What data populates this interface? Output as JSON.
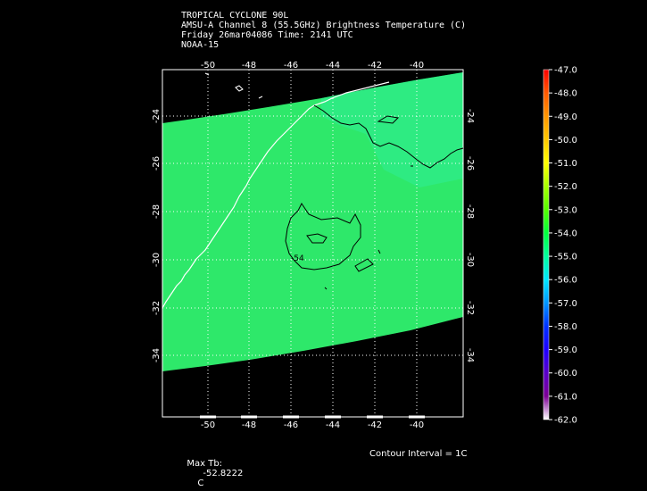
{
  "header": {
    "line1": "TROPICAL CYCLONE 90L",
    "line2": "AMSU-A Channel 8 (55.5GHz) Brightness Temperature (C)",
    "line3": "Friday 26mar04086 Time: 2141 UTC",
    "line4": "NOAA-15"
  },
  "map": {
    "lon_ticks": [
      "-50",
      "-48",
      "-46",
      "-44",
      "-42",
      "-40"
    ],
    "lat_ticks": [
      "-24",
      "-26",
      "-28",
      "-30",
      "-32",
      "-34"
    ],
    "contour_label": "-54",
    "swath_color": "#2ee86a",
    "colors": {
      "background": "#000000",
      "coastline": "#ffffff",
      "contour": "#000000"
    }
  },
  "colorbar": {
    "labels": [
      "-47.0",
      "-48.0",
      "-49.0",
      "-50.0",
      "-51.0",
      "-52.0",
      "-53.0",
      "-54.0",
      "-55.0",
      "-56.0",
      "-57.0",
      "-58.0",
      "-59.0",
      "-60.0",
      "-61.0",
      "-62.0"
    ],
    "colors": [
      "#ff0000",
      "#ff5a00",
      "#ff9600",
      "#ffc800",
      "#ffff00",
      "#a6ff00",
      "#55ff00",
      "#00ff3c",
      "#00ff9e",
      "#00e6ff",
      "#0096ff",
      "#0032ff",
      "#1e00ff",
      "#5a00c8",
      "#7d0096",
      "#ffffff"
    ]
  },
  "footer": {
    "max_tb_label": "Max Tb:",
    "max_tb_value": "-52.8222",
    "max_tb_unit": "C",
    "contour_interval": "Contour Interval = 1C"
  }
}
